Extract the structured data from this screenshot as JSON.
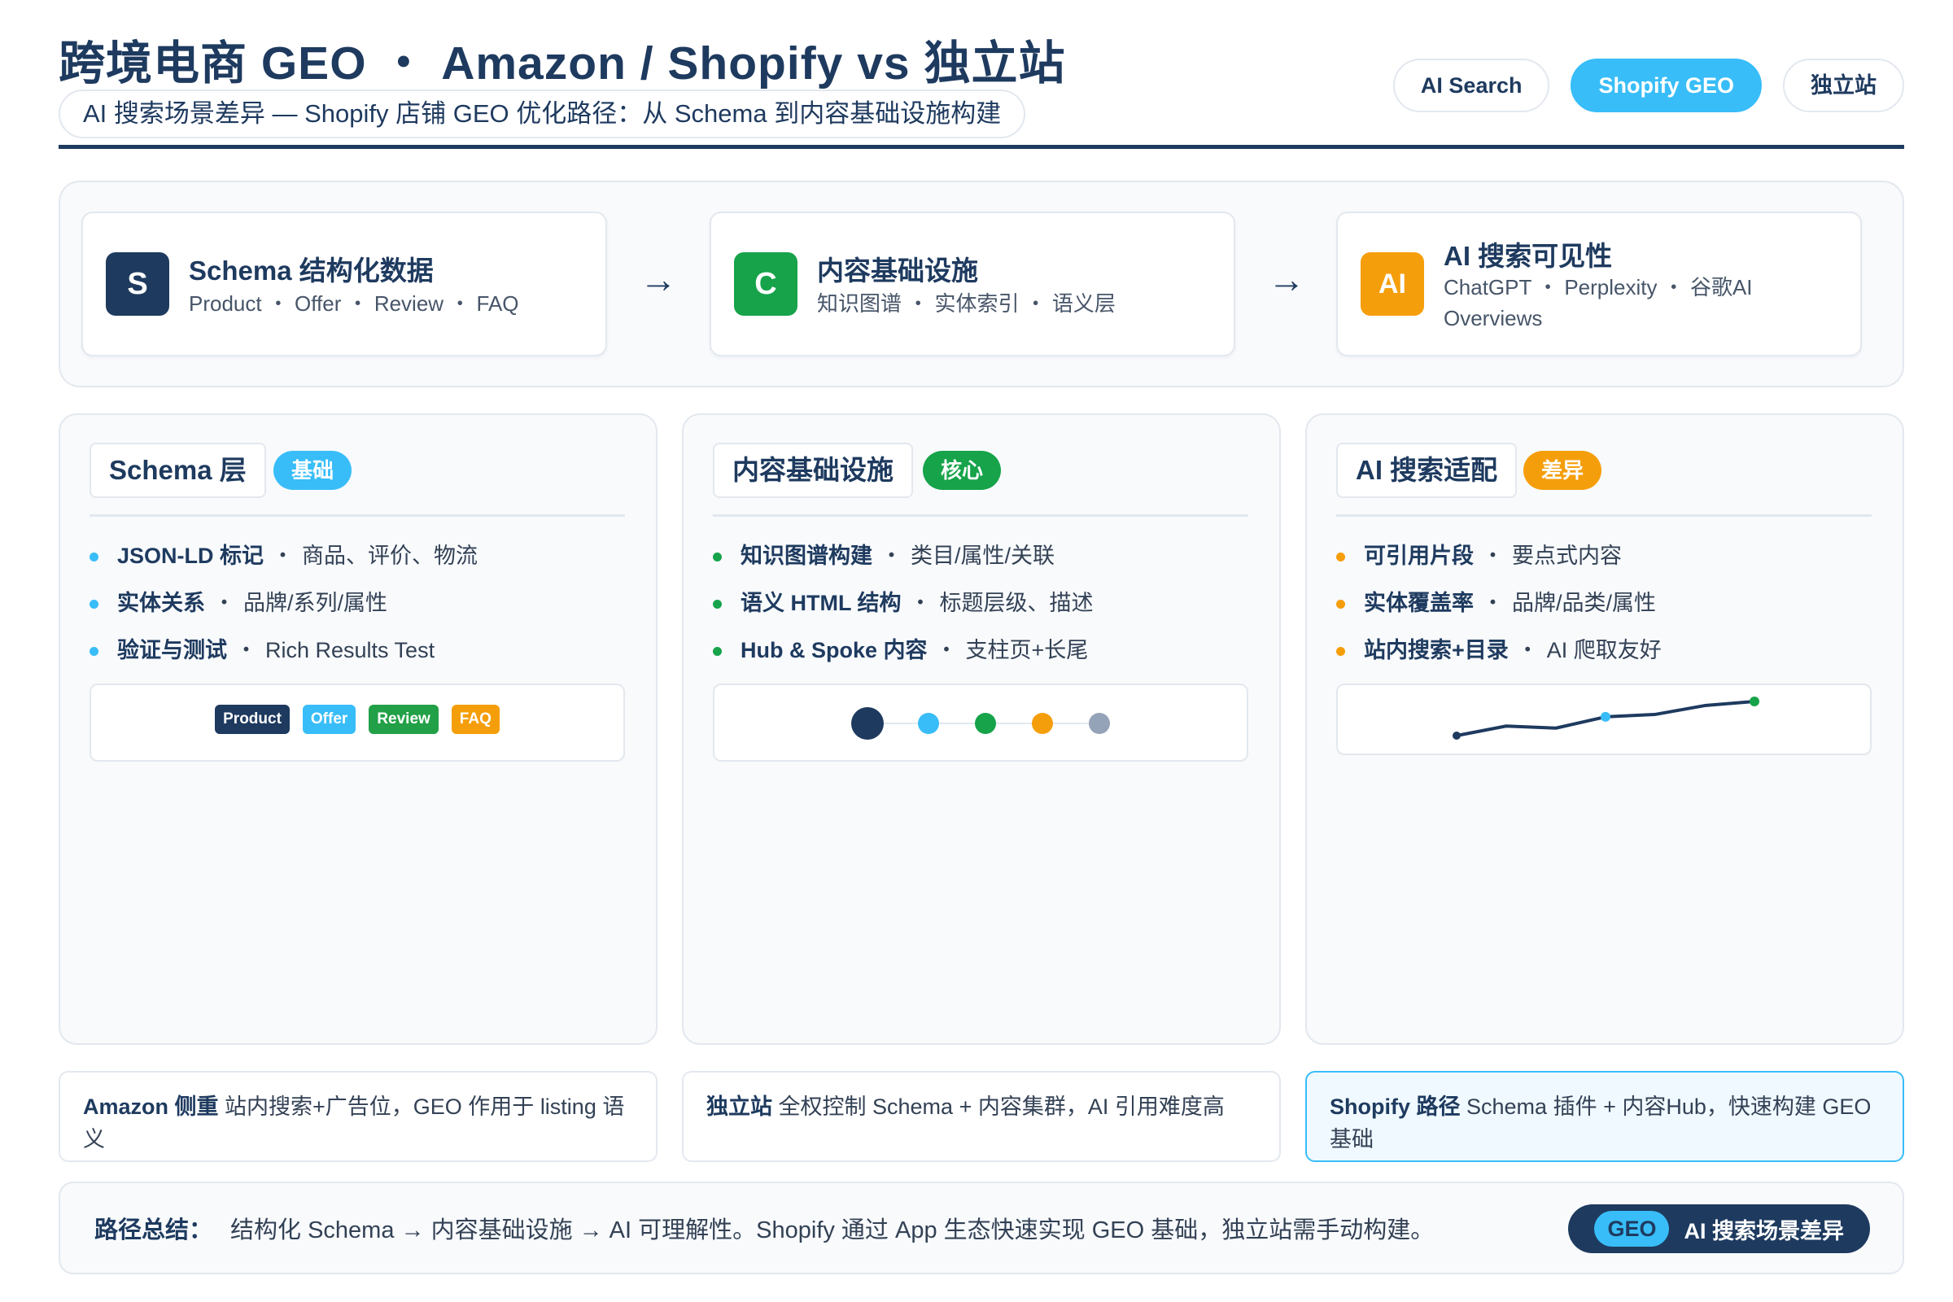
{
  "header": {
    "title": "跨境电商 GEO ・ Amazon / Shopify vs 独立站",
    "subtitle": "AI 搜索场景差异 — Shopify 店铺 GEO 优化路径：从 Schema 到内容基础设施构建",
    "tags": [
      {
        "label": "AI Search",
        "active": false
      },
      {
        "label": "Shopify GEO",
        "active": true
      },
      {
        "label": "独立站",
        "active": false
      }
    ]
  },
  "flow": {
    "arrow": "→",
    "steps": [
      {
        "badge": "S",
        "color": "#1e3a5f",
        "title": "Schema 结构化数据",
        "desc": "Product ・ Offer ・ Review ・ FAQ"
      },
      {
        "badge": "C",
        "color": "#16a34a",
        "title": "内容基础设施",
        "desc": "知识图谱 ・ 实体索引 ・ 语义层"
      },
      {
        "badge": "AI",
        "color": "#f59e0b",
        "title": "AI 搜索可见性",
        "desc": "ChatGPT ・ Perplexity ・ 谷歌AI Overviews"
      }
    ]
  },
  "columns": [
    {
      "heading": "Schema 层",
      "badge": "基础",
      "badge_color": "#38bdf8",
      "bullet_color": "#38bdf8",
      "items": [
        {
          "label": "JSON-LD 标记",
          "desc": "商品、评价、物流"
        },
        {
          "label": "实体关系",
          "desc": "品牌/系列/属性"
        },
        {
          "label": "验证与测试",
          "desc": "Rich Results Test"
        }
      ],
      "pills": [
        {
          "label": "Product",
          "color": "#1e3a5f"
        },
        {
          "label": "Offer",
          "color": "#38bdf8"
        },
        {
          "label": "Review",
          "color": "#22a047"
        },
        {
          "label": "FAQ",
          "color": "#f59e0b"
        }
      ]
    },
    {
      "heading": "内容基础设施",
      "badge": "核心",
      "badge_color": "#16a34a",
      "bullet_color": "#16a34a",
      "items": [
        {
          "label": "知识图谱构建",
          "desc": "类目/属性/关联"
        },
        {
          "label": "语义 HTML 结构",
          "desc": "标题层级、描述"
        },
        {
          "label": "Hub & Spoke 内容",
          "desc": "支柱页+长尾"
        }
      ],
      "dots": [
        {
          "color": "#1e3a5f"
        },
        {
          "color": "#38bdf8"
        },
        {
          "color": "#16a34a"
        },
        {
          "color": "#f59e0b"
        },
        {
          "color": "#94a3b8"
        }
      ]
    },
    {
      "heading": "AI 搜索适配",
      "badge": "差异",
      "badge_color": "#f59e0b",
      "bullet_color": "#f59e0b",
      "items": [
        {
          "label": "可引用片段",
          "desc": "要点式内容"
        },
        {
          "label": "实体覆盖率",
          "desc": "品牌/品类/属性"
        },
        {
          "label": "站内搜索+目录",
          "desc": "AI 爬取友好"
        }
      ],
      "sparkline": {
        "line_color": "#1e3a5f",
        "values": [
          0.0,
          0.28,
          0.22,
          0.55,
          0.62,
          0.88,
          1.0
        ],
        "highlights": [
          {
            "index": 3,
            "color": "#38bdf8"
          },
          {
            "index": 6,
            "color": "#16a34a"
          }
        ]
      }
    }
  ],
  "notes": [
    {
      "bold": "Amazon 侧重",
      "text": "站内搜索+广告位，GEO 作用于 listing 语义",
      "highlight": false
    },
    {
      "bold": "独立站",
      "text": "全权控制 Schema + 内容集群，AI 引用难度高",
      "highlight": false
    },
    {
      "bold": "Shopify 路径",
      "text": "Schema 插件 + 内容Hub，快速构建 GEO 基础",
      "highlight": true
    }
  ],
  "summary": {
    "label": "路径总结：",
    "text": "结构化 Schema → 内容基础设施 → AI 可理解性。Shopify 通过 App 生态快速实现 GEO 基础，独立站需手动构建。",
    "badge_geo": "GEO",
    "badge_text": "AI 搜索场景差异"
  }
}
